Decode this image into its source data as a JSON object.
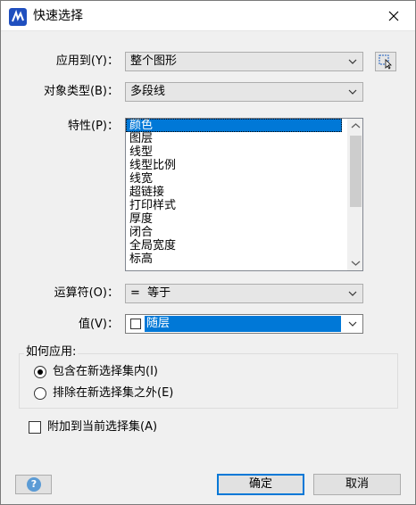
{
  "window": {
    "title": "快速选择"
  },
  "apply_to": {
    "label": "应用到(Y)：",
    "value": "整个图形"
  },
  "object_type": {
    "label": "对象类型(B)：",
    "value": "多段线"
  },
  "properties": {
    "label": "特性(P)：",
    "items": [
      "颜色",
      "图层",
      "线型",
      "线型比例",
      "线宽",
      "超链接",
      "打印样式",
      "厚度",
      "闭合",
      "全局宽度",
      "标高"
    ],
    "selected": "颜色"
  },
  "operator": {
    "label": "运算符(O)：",
    "value": "=  等于"
  },
  "value_field": {
    "label": "值(V)：",
    "value": "随层"
  },
  "how_to_apply": {
    "title": "如何应用:",
    "include_label": "包含在新选择集内(I)",
    "exclude_label": "排除在新选择集之外(E)"
  },
  "append_label": "附加到当前选择集(A)",
  "buttons": {
    "ok": "确定",
    "cancel": "取消"
  },
  "colors": {
    "accent": "#0078d7",
    "help": "#5b9bd5"
  }
}
